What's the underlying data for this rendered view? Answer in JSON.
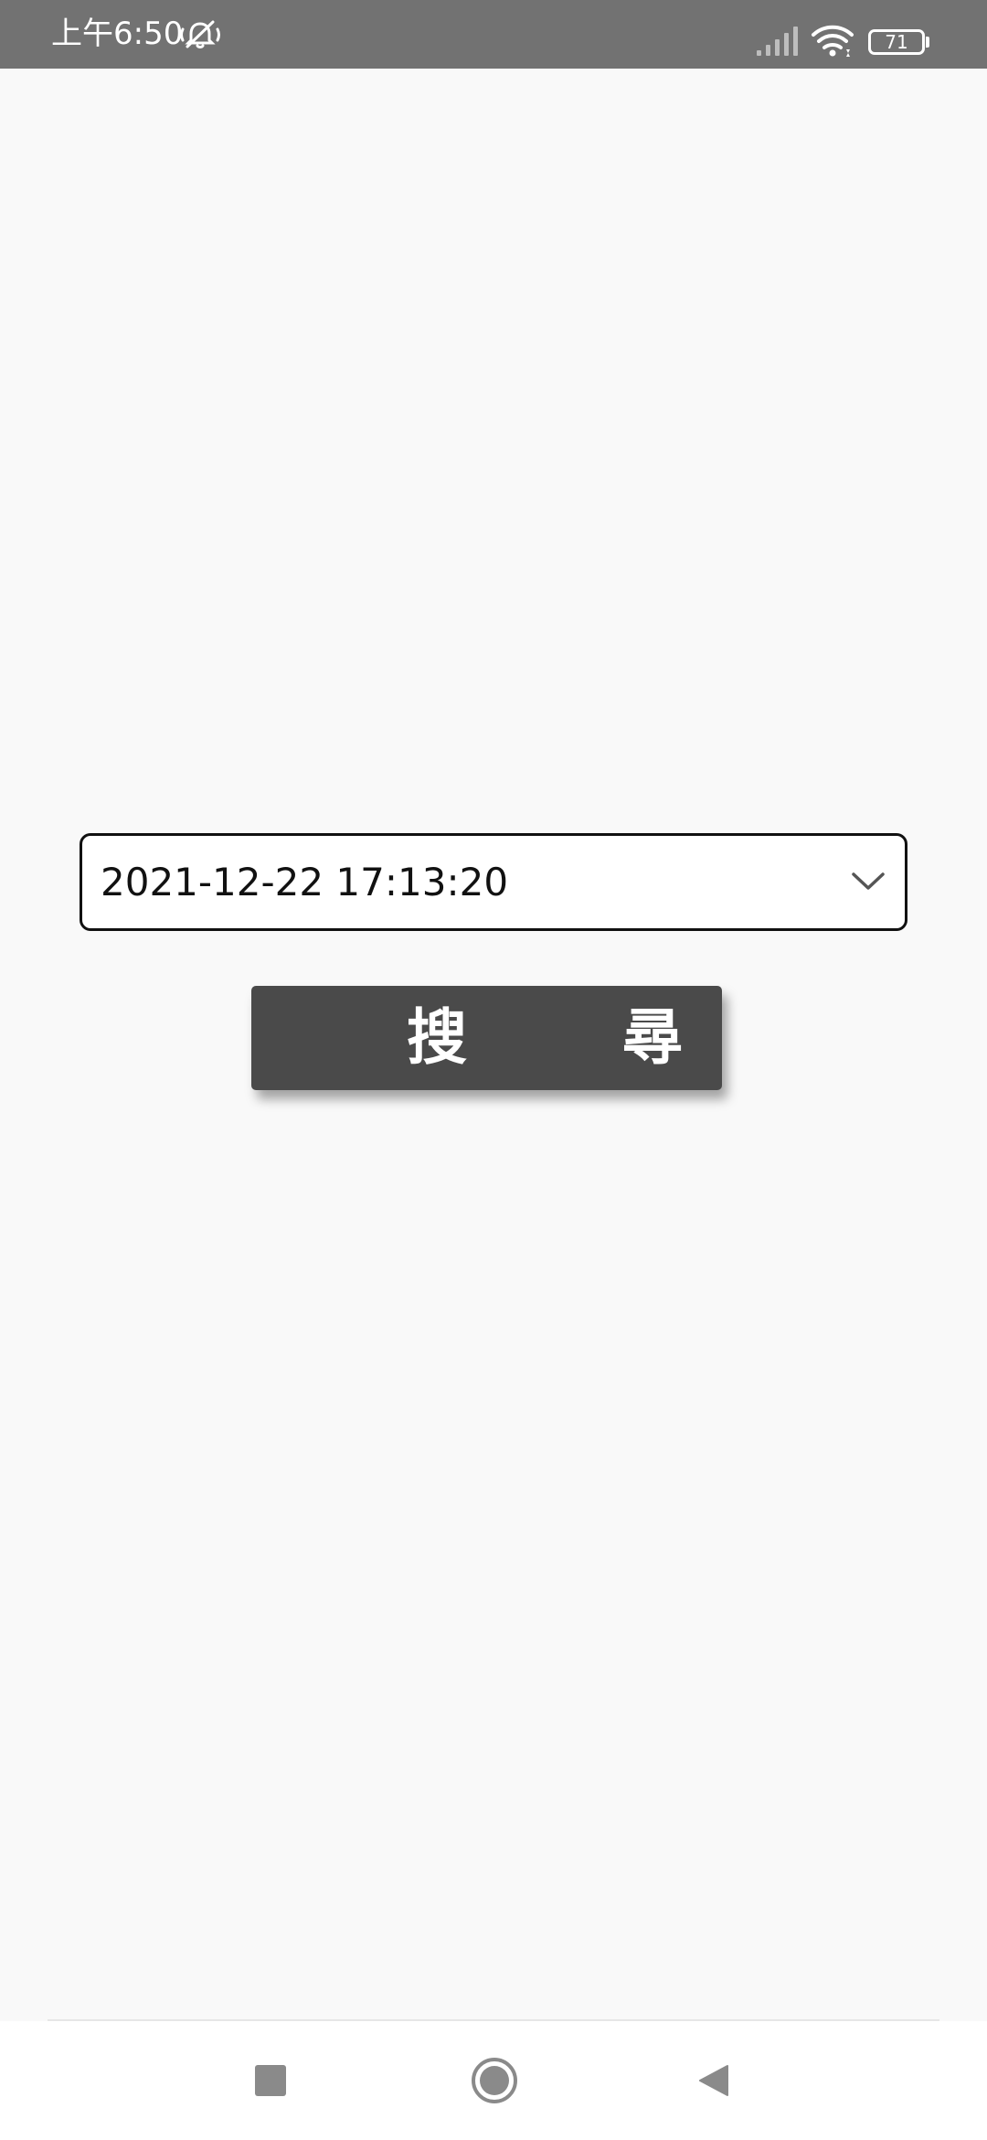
{
  "status_bar": {
    "time": "上午6:50",
    "battery_level": "71",
    "icons": [
      "mute-icon",
      "signal-icon",
      "wifi-icon",
      "battery-icon"
    ]
  },
  "date_picker": {
    "value": "2021-12-22 17:13:20",
    "icon": "chevron-down-icon"
  },
  "search_button": {
    "label": "搜尋"
  },
  "nav_bar": {
    "icons": [
      "recents-icon",
      "home-icon",
      "back-icon"
    ]
  },
  "colors": {
    "status_bar": "#727272",
    "background": "#f9f9f9",
    "button": "#4a4a4a",
    "nav_icon": "#8a8a8a"
  }
}
